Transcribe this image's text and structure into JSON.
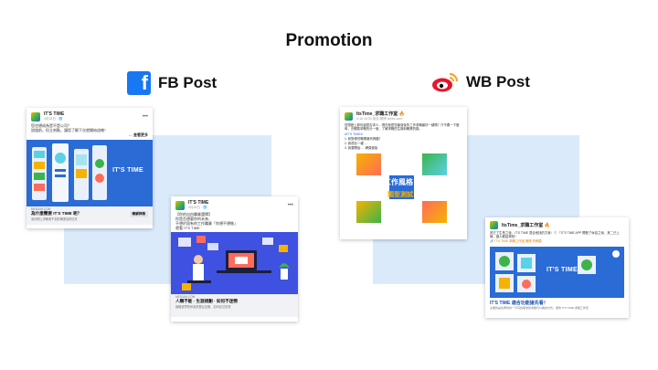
{
  "page": {
    "title": "Promotion"
  },
  "fb": {
    "label": "FB Post",
    "post1": {
      "page_name": "IT'S TIME",
      "timestamp": "4月18日 · 🌐",
      "text1": "您也想成為是不是公司？",
      "text2": "說道前，但立刻點，讓您了解下次就開始這樣！",
      "see_more": "… 查看更多",
      "banner_text": "IT'S TIME",
      "domain": "MEDIUM.COM",
      "link_title": "為什麼需要 IT'S TIME 呢？",
      "link_sub": "為何網上求職看不到的職業說明文件",
      "cta": "瞭解詳情"
    },
    "post2": {
      "page_name": "IT'S TIME",
      "timestamp": "4月18日 · 🌐",
      "text1": "【你的自由職業選擇】",
      "text2": "你是否想要你的未來、",
      "text3": "不想於固有的工作職業「你想不想做」",
      "text4": "就看 IT'S TIME",
      "domain": "MEDIUM.COM",
      "link_title": "人類不能 · 生涯規劃 · 如何不迷惘",
      "link_sub": "論職選擇對你最重要且至關、如何定位的是",
      "cta": "瞭解詳情"
    }
  },
  "wb": {
    "label": "WB Post",
    "post1": {
      "account": "ItsTime_求職工作室 🔥",
      "time": "4-18 16:30 來自 微博 weibo.com",
      "text1": "您想做上那你還是否求人，現在就是您最強後的工作求職最好一種嗎？只不要一下做時，去體驗求職的分一個，了解求職的生與新職業的路。",
      "link": "#IT'S TIME#",
      "line2": "1. 我對哪些職業最有興趣？",
      "line3": "2. 我適合一種 …",
      "line4": "3. 我要開始 …  網頁鏈接",
      "overlay1": "工作風格",
      "overlay2": "類型測試"
    },
    "post2": {
      "account": "ItsTime_求職工作室 🔥",
      "text1": "其它了生長之後，IT'S TIME 適合他找的方案：① 「IT'S TIME APP 開發了休息之後，其二已上線，讓人輕鬆得到！",
      "link": "🔗 IT'S TIME 求職工作室 微博 的網頁",
      "banner_text": "IT'S TIME",
      "link_title": "IT'S TIME 適合功能搶先看！",
      "link_sub": "主要的是先著你的一不同的需求從求職可以看的方式，邀你 IT'S TIME 求職工作室"
    }
  },
  "colors": {
    "panel": "#dbeafb",
    "fb_blue": "#1877f2",
    "promo_blue": "#2a6bd6",
    "weibo_red": "#e6162d"
  }
}
